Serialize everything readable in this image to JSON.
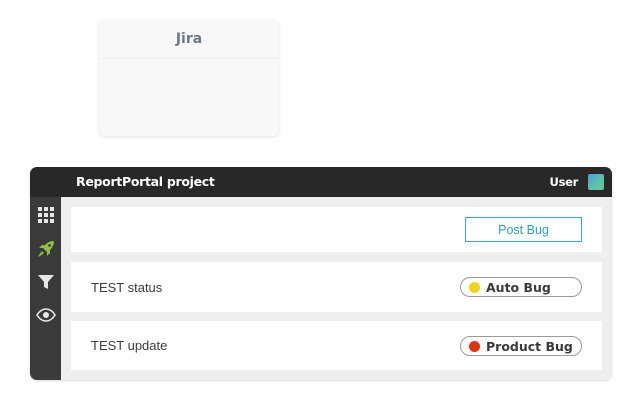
{
  "jira_card": {
    "title": "Jira"
  },
  "app": {
    "project_name": "ReportPortal project",
    "user_label": "User",
    "sidebar": [
      {
        "icon": "grid-icon",
        "name": "sidebar-dashboards",
        "active": false
      },
      {
        "icon": "rocket-icon",
        "name": "sidebar-launches",
        "active": true
      },
      {
        "icon": "filter-icon",
        "name": "sidebar-filters",
        "active": false
      },
      {
        "icon": "eye-icon",
        "name": "sidebar-debug",
        "active": false
      }
    ],
    "toolbar": {
      "post_bug_label": "Post Bug"
    },
    "rows": [
      {
        "label": "TEST status",
        "defect": "Auto Bug",
        "defect_color": "#f3d21c"
      },
      {
        "label": "TEST update",
        "defect": "Product Bug",
        "defect_color": "#e0330e"
      }
    ],
    "colors": {
      "accent": "#2a9fb0",
      "active_icon": "#8fc043"
    }
  }
}
